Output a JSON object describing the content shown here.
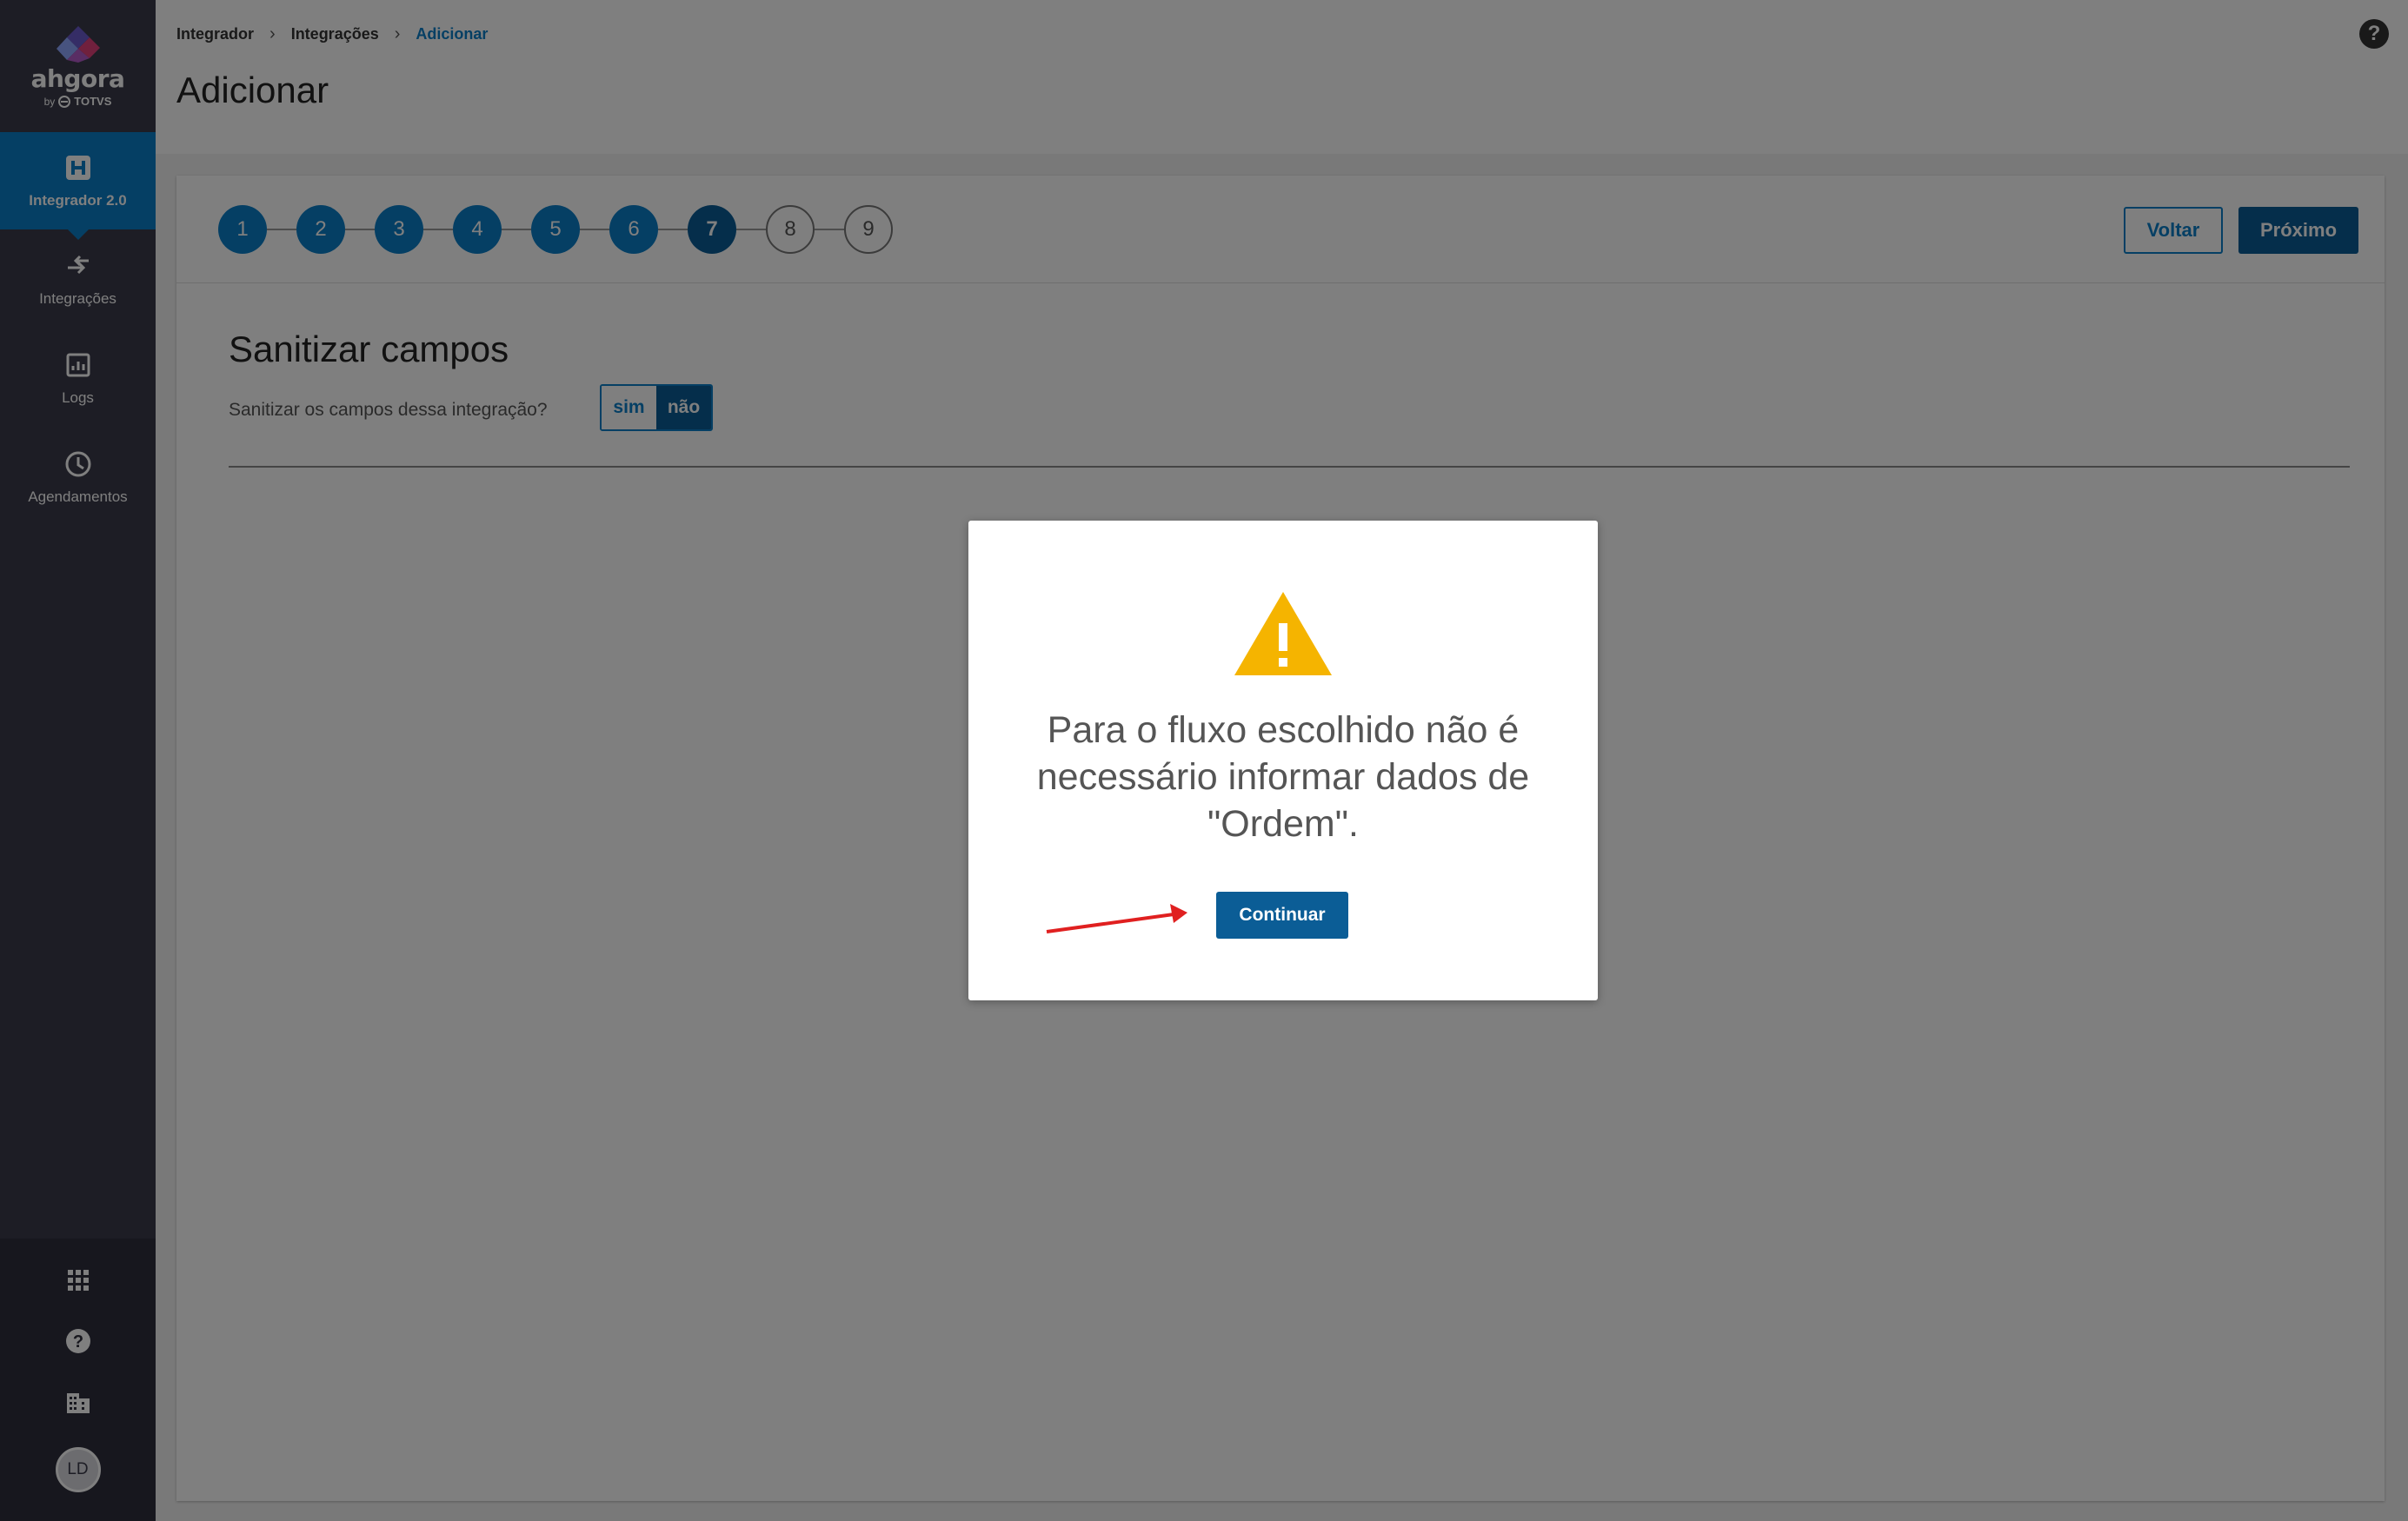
{
  "sidebar": {
    "brand": {
      "name": "ahgora",
      "by": "by",
      "partner": "TOTVS"
    },
    "items": [
      {
        "label": "Integrador 2.0",
        "icon": "integrator-icon",
        "active": true
      },
      {
        "label": "Integrações",
        "icon": "swap-arrows-icon"
      },
      {
        "label": "Logs",
        "icon": "chart-report-icon"
      },
      {
        "label": "Agendamentos",
        "icon": "clock-icon"
      }
    ],
    "bottom": {
      "apps_icon": "apps-grid-icon",
      "help_icon": "help-circle-icon",
      "company_icon": "building-icon",
      "avatar_initials": "LD"
    }
  },
  "header": {
    "breadcrumb": [
      "Integrador",
      "Integrações",
      "Adicionar"
    ],
    "title": "Adicionar",
    "help_icon": "help-circle-icon"
  },
  "wizard": {
    "steps": [
      {
        "label": "1",
        "state": "done"
      },
      {
        "label": "2",
        "state": "done"
      },
      {
        "label": "3",
        "state": "done"
      },
      {
        "label": "4",
        "state": "done"
      },
      {
        "label": "5",
        "state": "done"
      },
      {
        "label": "6",
        "state": "done"
      },
      {
        "label": "7",
        "state": "current"
      },
      {
        "label": "8",
        "state": "todo"
      },
      {
        "label": "9",
        "state": "todo"
      }
    ],
    "back_label": "Voltar",
    "next_label": "Próximo"
  },
  "section": {
    "title": "Sanitizar campos",
    "question": "Sanitizar os campos dessa integração?",
    "toggle_yes": "sim",
    "toggle_no": "não",
    "selected": "não"
  },
  "modal": {
    "icon": "warning-triangle-icon",
    "message": "Para o fluxo escolhido não é necessário informar dados de \"Ordem\".",
    "button_label": "Continuar"
  },
  "colors": {
    "sidebar_bg": "#3a3a4a",
    "accent": "#0b7ec8",
    "accent_dark": "#0b5d96",
    "warning": "#f5b400",
    "annotation_arrow": "#e02020"
  }
}
